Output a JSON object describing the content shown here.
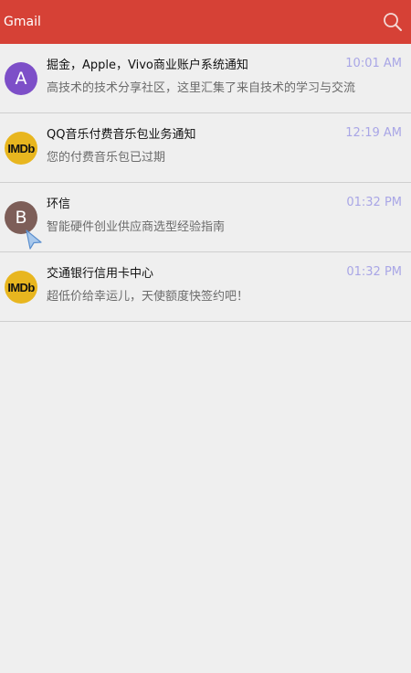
{
  "app": {
    "title": "Gmail",
    "header_color": "#d64136"
  },
  "toolbar": {
    "search_icon": "search-icon"
  },
  "emails": [
    {
      "avatar_type": "letter",
      "avatar_letter": "A",
      "avatar_color": "#7d4fc8",
      "sender": "掘金，Apple，Vivo商业账户系统通知",
      "snippet": "高技术的技术分享社区，这里汇集了来自技术的学习与交流",
      "time": "10:01 AM"
    },
    {
      "avatar_type": "imdb",
      "avatar_letter": "IMDb",
      "avatar_color": "#e8b61f",
      "sender": "QQ音乐付费音乐包业务通知",
      "snippet": "您的付费音乐包已过期",
      "time": "12:19 AM"
    },
    {
      "avatar_type": "letter",
      "avatar_letter": "B",
      "avatar_color": "#7d5e58",
      "sender": "环信",
      "snippet": "智能硬件创业供应商选型经验指南",
      "time": "01:32 PM"
    },
    {
      "avatar_type": "imdb",
      "avatar_letter": "IMDb",
      "avatar_color": "#e8b61f",
      "sender": "交通银行信用卡中心",
      "snippet": "超低价给幸运儿，天使额度快签约吧！",
      "time": "01:32 PM"
    }
  ],
  "colors": {
    "time_text": "#a9a6e6",
    "snippet_text": "#6b6b6b",
    "background": "#efefef"
  }
}
